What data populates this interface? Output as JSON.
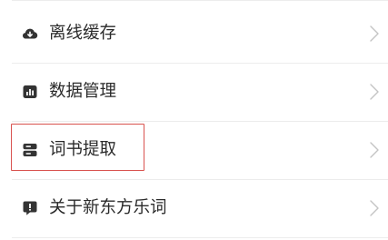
{
  "menu": {
    "items": [
      {
        "label": "离线缓存",
        "icon": "cloud-download-icon"
      },
      {
        "label": "数据管理",
        "icon": "bar-chart-icon"
      },
      {
        "label": "词书提取",
        "icon": "storage-icon"
      },
      {
        "label": "关于新东方乐词",
        "icon": "info-chat-icon"
      }
    ],
    "chevron_icon": "chevron-right-icon",
    "highlight_color": "#d9534f",
    "icon_color": "#333333"
  }
}
